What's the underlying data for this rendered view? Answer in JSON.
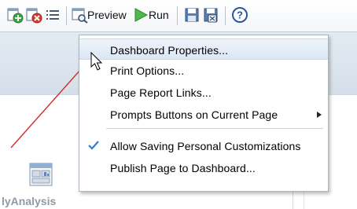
{
  "toolbar": {
    "preview_label": "Preview",
    "run_label": "Run"
  },
  "page": {
    "analysis_label": "lyAnalysis"
  },
  "menu": {
    "items": [
      {
        "label": "Dashboard Properties..."
      },
      {
        "label": "Print Options..."
      },
      {
        "label": "Page Report Links..."
      },
      {
        "label": "Prompts Buttons on Current Page"
      },
      {
        "label": "Allow Saving Personal Customizations"
      },
      {
        "label": "Publish Page to Dashboard..."
      }
    ]
  },
  "colors": {
    "highlight": "#dbe7f4",
    "pointer_line": "#d42a2a",
    "check": "#2f7fd6"
  }
}
